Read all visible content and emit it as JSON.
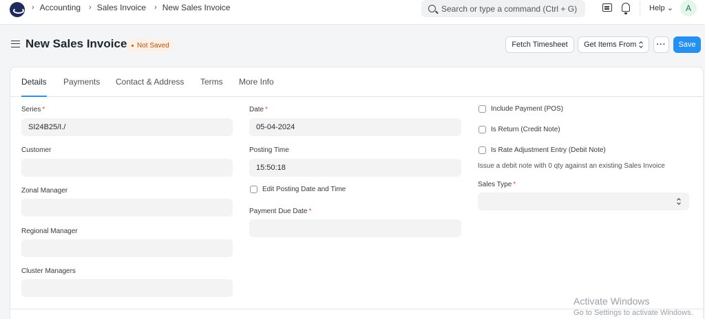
{
  "breadcrumbs": [
    "Accounting",
    "Sales Invoice",
    "New Sales Invoice"
  ],
  "search": {
    "placeholder": "Search or type a command (Ctrl + G)"
  },
  "navbar": {
    "help_label": "Help",
    "avatar_initial": "A"
  },
  "page": {
    "title": "New Sales Invoice",
    "status": "Not Saved",
    "buttons": {
      "fetch_timesheet": "Fetch Timesheet",
      "get_items_from": "Get Items From",
      "more": "···",
      "save": "Save"
    }
  },
  "tabs": [
    "Details",
    "Payments",
    "Contact & Address",
    "Terms",
    "More Info"
  ],
  "form": {
    "series": {
      "label": "Series",
      "value": "SI24B25/I./"
    },
    "customer": {
      "label": "Customer",
      "value": ""
    },
    "zonal_manager": {
      "label": "Zonal Manager",
      "value": ""
    },
    "regional_manager": {
      "label": "Regional Manager",
      "value": ""
    },
    "cluster_managers": {
      "label": "Cluster Managers",
      "value": ""
    },
    "date": {
      "label": "Date",
      "value": "05-04-2024"
    },
    "posting_time": {
      "label": "Posting Time",
      "value": "15:50:18"
    },
    "edit_posting": {
      "label": "Edit Posting Date and Time"
    },
    "payment_due_date": {
      "label": "Payment Due Date",
      "value": ""
    },
    "include_payment": {
      "label": "Include Payment (POS)"
    },
    "is_return": {
      "label": "Is Return (Credit Note)"
    },
    "is_rate_adjustment": {
      "label": "Is Rate Adjustment Entry (Debit Note)"
    },
    "rate_adjustment_desc": "Issue a debit note with 0 qty against an existing Sales Invoice",
    "sales_type": {
      "label": "Sales Type",
      "value": ""
    }
  },
  "watermark": {
    "line1": "Activate Windows",
    "line2": "Go to Settings to activate Windows."
  }
}
